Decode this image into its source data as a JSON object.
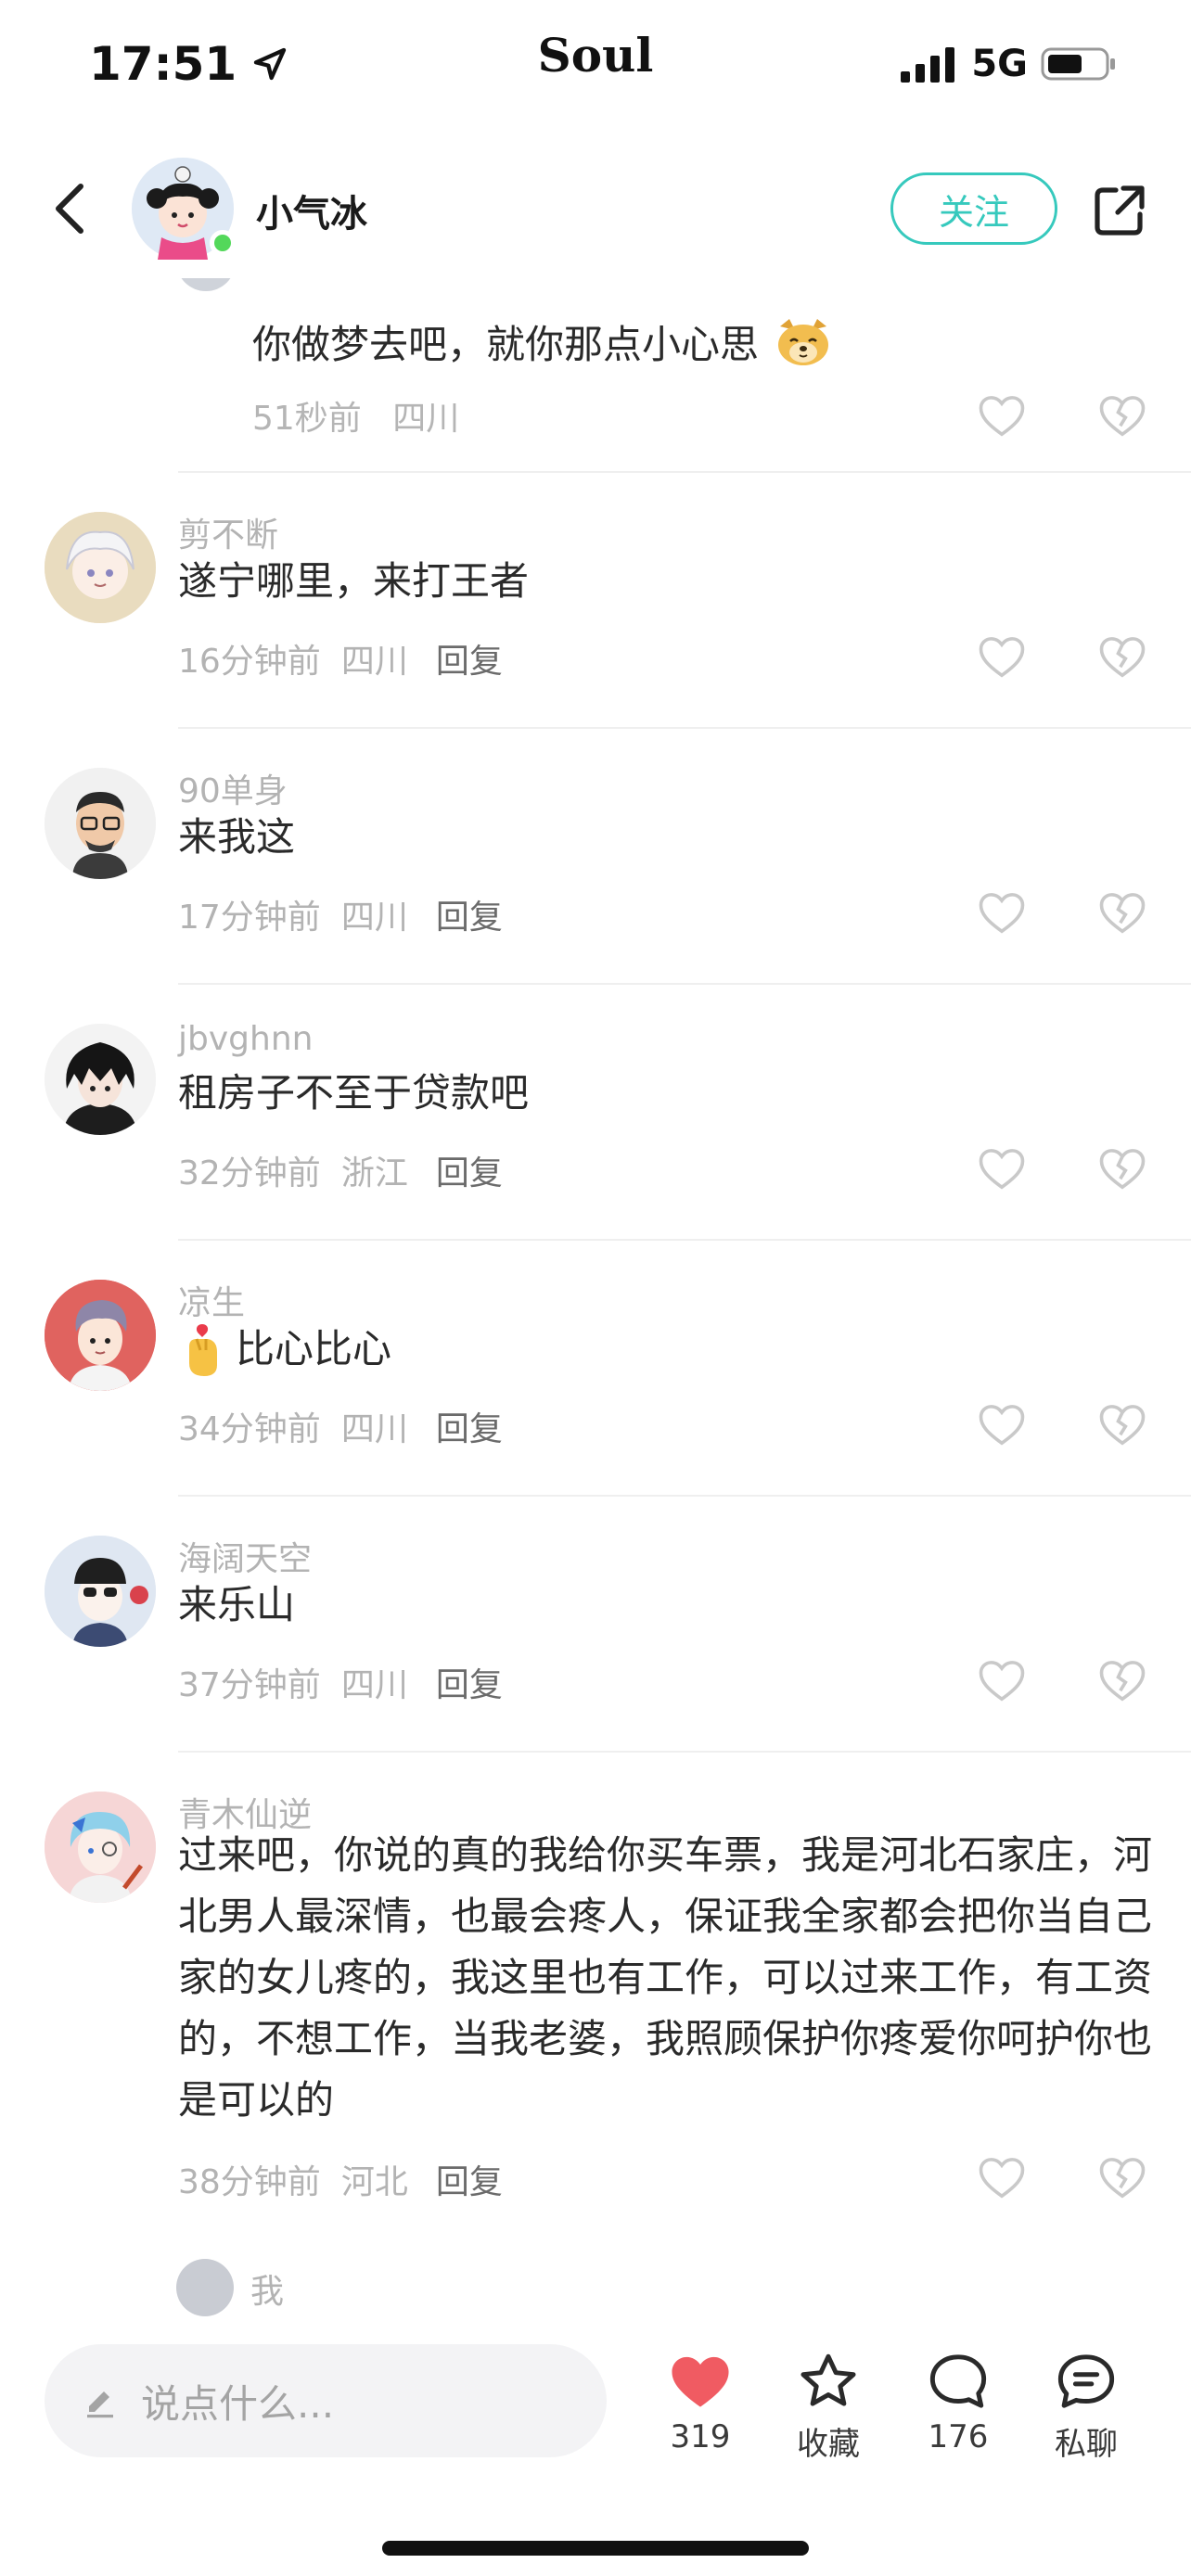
{
  "status_bar": {
    "time": "17:51",
    "app_name": "Soul",
    "network": "5G"
  },
  "header": {
    "username": "小气冰",
    "follow_label": "关注"
  },
  "top_reply": {
    "text": "你做梦去吧，就你那点小心思",
    "time": "51秒前",
    "location": "四川"
  },
  "comments": [
    {
      "user": "剪不断",
      "text": "遂宁哪里，来打王者",
      "time": "16分钟前",
      "location": "四川",
      "reply": "回复"
    },
    {
      "user": "90单身",
      "text": "来我这",
      "time": "17分钟前",
      "location": "四川",
      "reply": "回复"
    },
    {
      "user": "jbvghnn",
      "text": "租房子不至于贷款吧",
      "time": "32分钟前",
      "location": "浙江",
      "reply": "回复"
    },
    {
      "user": "凉生",
      "text": "比心比心",
      "time": "34分钟前",
      "location": "四川",
      "reply": "回复"
    },
    {
      "user": "海阔天空",
      "text": "来乐山",
      "time": "37分钟前",
      "location": "四川",
      "reply": "回复"
    },
    {
      "user": "青木仙逆",
      "text": "过来吧，你说的真的我给你买车票，我是河北石家庄，河北男人最深情，也最会疼人，保证我全家都会把你当自己家的女儿疼的，我这里也有工作，可以过来工作，有工资的，不想工作，当我老婆，我照顾保护你疼爱你呵护你也是可以的",
      "time": "38分钟前",
      "location": "河北",
      "reply": "回复"
    }
  ],
  "sub_reply_user": "我",
  "bottom_bar": {
    "input_placeholder": "说点什么...",
    "likes": "319",
    "favorite_label": "收藏",
    "comments_count": "176",
    "chat_label": "私聊"
  },
  "colors": {
    "accent": "#36c9bd",
    "like": "#f05b62",
    "online": "#53d85a"
  }
}
